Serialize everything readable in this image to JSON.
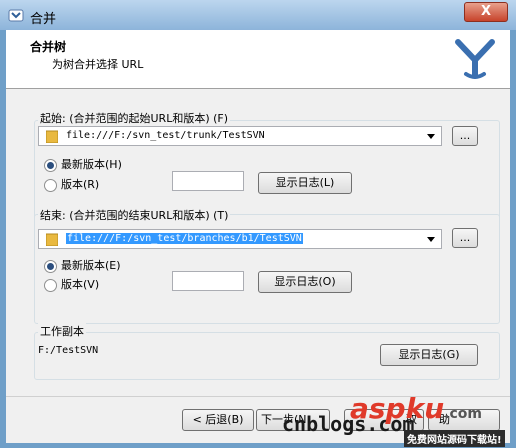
{
  "window": {
    "title": "合并",
    "close_glyph": "X"
  },
  "header": {
    "title": "合并树",
    "subtitle": "为树合并选择 URL"
  },
  "start": {
    "label": "起始: (合并范围的起始URL和版本) (F)",
    "url": "file:///F:/svn_test/trunk/TestSVN",
    "browse_label": "...",
    "option_latest": "最新版本(H)",
    "option_revision": "版本(R)",
    "revision_value": "",
    "show_log_label": "显示日志(L)"
  },
  "end": {
    "label": "结束: (合并范围的结束URL和版本) (T)",
    "url": "file:///F:/svn_test/branches/b1/TestSVN",
    "browse_label": "...",
    "option_latest": "最新版本(E)",
    "option_revision": "版本(V)",
    "revision_value": "",
    "show_log_label": "显示日志(O)"
  },
  "working_copy": {
    "label": "工作副本",
    "path": "F:/TestSVN",
    "show_log_label": "显示日志(G)"
  },
  "footer": {
    "back_label": "< 后退(B)",
    "next_label": "下一步(N",
    "cancel_partial": "取",
    "help_partial": "助"
  },
  "watermark": {
    "site": "cnblogs.com",
    "brand_asp": "asp",
    "brand_ku": "ku",
    "brand_com": ".com",
    "tagline": "免费网站源码下载站!"
  },
  "colors": {
    "accent_blue": "#2f5f98",
    "selection": "#3399ff",
    "watermark_red": "#e03a2a"
  }
}
